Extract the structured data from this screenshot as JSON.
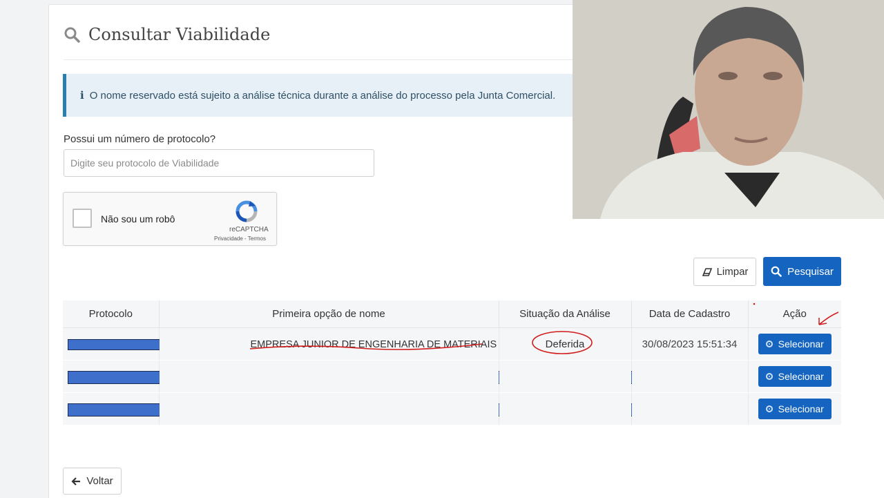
{
  "page": {
    "title": "Consultar Viabilidade",
    "title_icon": "search-icon"
  },
  "alert": {
    "icon": "info-icon",
    "text": "O nome reservado está sujeito a análise técnica durante a análise do processo pela Junta Comercial."
  },
  "protocol": {
    "label": "Possui um número de protocolo?",
    "placeholder": "Digite seu protocolo de Viabilidade",
    "value": ""
  },
  "recaptcha": {
    "checkbox_label": "Não sou um robô",
    "brand": "reCAPTCHA",
    "links": "Privacidade - Termos",
    "checked": false
  },
  "actions": {
    "clear_label": "Limpar",
    "clear_icon": "eraser-icon",
    "search_label": "Pesquisar",
    "search_icon": "search-icon"
  },
  "table": {
    "headers": [
      "Protocolo",
      "Primeira opção de nome",
      "Situação da Análise",
      "Data de Cadastro",
      "Ação"
    ],
    "rows": [
      {
        "protocol": "",
        "name": "EMPRESA JUNIOR DE ENGENHARIA DE MATERIAIS",
        "status": "Deferida",
        "date": "30/08/2023 15:51:34",
        "action": "Selecionar"
      },
      {
        "protocol": "",
        "name": "",
        "status": "",
        "date": "",
        "action": "Selecionar"
      },
      {
        "protocol": "",
        "name": "",
        "status": "",
        "date": "",
        "action": "Selecionar"
      }
    ]
  },
  "footer": {
    "back_label": "Voltar",
    "back_icon": "arrow-left-icon"
  },
  "colors": {
    "primary": "#1565c0",
    "alert_border": "#2b7fb0",
    "alert_bg": "#e6f0f6",
    "redaction": "#3d6fcb",
    "annotation": "#d11a1a"
  }
}
